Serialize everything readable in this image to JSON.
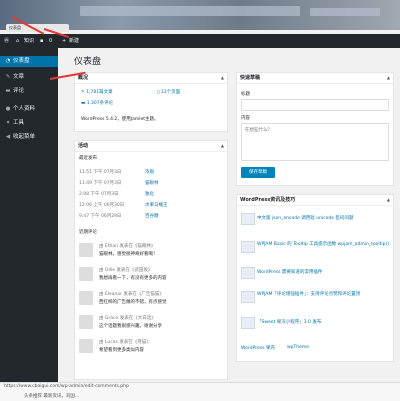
{
  "browser": {
    "tab_title": "仪表盘",
    "status_url": "https://www.cbaigui.com/wp-admin/edit-comments.php",
    "taskbar_text": "头条推荐  最新资讯，刘国..."
  },
  "adminbar": {
    "site_name": "知识",
    "comments_count": "0",
    "new_label": "新建"
  },
  "sidebar": {
    "items": [
      {
        "label": "仪表盘",
        "icon": "dashboard-icon"
      },
      {
        "label": "文章",
        "icon": "pin-icon"
      },
      {
        "label": "评论",
        "icon": "comment-icon"
      },
      {
        "label": "个人资料",
        "icon": "user-icon"
      },
      {
        "label": "工具",
        "icon": "wrench-icon"
      },
      {
        "label": "收起菜单",
        "icon": "collapse-icon"
      }
    ]
  },
  "page": {
    "title": "仪表盘"
  },
  "glance": {
    "title": "概况",
    "posts": "1,781篇文章",
    "pages": "13个页面",
    "comments": "1,307条评论",
    "footer": "WordPress 5.4.2，使用Jamlet主题。"
  },
  "activity": {
    "title": "活动",
    "recent_published": "最近发布",
    "published": [
      {
        "time": "11:51 下午 07月3日",
        "title": "浓眉"
      },
      {
        "time": "11:49 下午 07月3日",
        "title": "猫眼林"
      },
      {
        "time": "2:08 下午 07月3日",
        "title": "独化"
      },
      {
        "time": "12:06 上午 06月30日",
        "title": "水果马桶王"
      },
      {
        "time": "9:47 下午 06月29日",
        "title": "百谷糖"
      }
    ],
    "recent_comments": "近期评论",
    "comments": [
      {
        "meta": "由 Ethan 发表在《猫眼林》",
        "text": "猫眼林，感觉很神奇好看啊！"
      },
      {
        "meta": "由 Ollie 发表在《武田坂》",
        "text": "我想再看一下，有没有更多的内容"
      },
      {
        "meta": "由 Eleanor 发表在《广告猫猫》",
        "text": "西红柿的广告做的不错，有点感觉"
      },
      {
        "meta": "由 Grace 发表在《大白话》",
        "text": "这个话题我很感兴趣，谢谢分享"
      },
      {
        "meta": "由 Lucas 发表在《月猫》",
        "text": "希望看到更多类似内容"
      }
    ]
  },
  "quickdraft": {
    "title": "快速草稿",
    "title_label": "标题",
    "content_label": "内容",
    "content_placeholder": "在想些什么？",
    "save_button": "保存草稿"
  },
  "news": {
    "title": "WordPress资讯及技巧",
    "items": [
      "中文版 json_encode 调用处 unicode 乱码问题",
      "WPJAM Basic 的 Tooltip 工具提示函数 wpjam_admin_tooltip()",
      "WordPress 需要知道的常用插件",
      "WPJAM「评论增强插件」：支持评论点赞和评论置顶",
      "「Sweet 果冻小程序」3.0 发布"
    ],
    "footer_links": [
      "WordPress 果壳",
      "wpTheme"
    ]
  },
  "colors": {
    "admin_dark": "#23282d",
    "accent_blue": "#0073aa",
    "annotation_red": "#e53935"
  }
}
